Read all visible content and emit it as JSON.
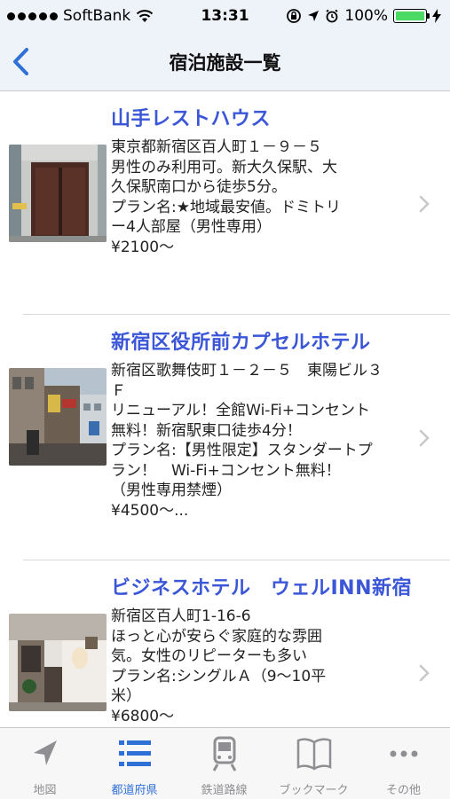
{
  "status": {
    "carrier": "SoftBank",
    "time": "13:31",
    "battery": "100%"
  },
  "nav": {
    "title": "宿泊施設一覧"
  },
  "listings": [
    {
      "name": "山手レストハウス",
      "lines": [
        "東京都新宿区百人町１－９－５",
        "男性のみ利用可。新大久保駅、大",
        "久保駅南口から徒歩5分。",
        "プラン名:★地域最安値。ドミトリ",
        "ー4人部屋（男性専用）",
        "¥2100〜"
      ]
    },
    {
      "name": "新宿区役所前カプセルホテル",
      "lines": [
        "新宿区歌舞伎町１－２－５　東陽ビル３",
        "Ｆ",
        "リニューアル！全館Wi-Fi+コンセント",
        "無料！新宿駅東口徒歩4分！",
        "プラン名:【男性限定】スタンダートプ",
        "ラン！　Wi-Fi+コンセント無料！",
        "（男性専用禁煙）",
        "¥4500〜..."
      ]
    },
    {
      "name": "ビジネスホテル　ウェルINN新宿",
      "lines": [
        "新宿区百人町1-16-6",
        "ほっと心が安らぐ家庭的な雰囲",
        "気。女性のリピーターも多い",
        "プラン名:シングルＡ（9〜10平",
        "米）",
        "¥6800〜"
      ]
    }
  ],
  "tabs": [
    {
      "label": "地図",
      "icon": "location-arrow-icon"
    },
    {
      "label": "都道府県",
      "icon": "list-icon",
      "active": true
    },
    {
      "label": "鉄道路線",
      "icon": "train-icon"
    },
    {
      "label": "ブックマーク",
      "icon": "book-icon"
    },
    {
      "label": "その他",
      "icon": "more-icon"
    }
  ],
  "colors": {
    "accent": "#2f6fd8",
    "title_link": "#3b57d8",
    "bar_background": "#eef2f9"
  }
}
